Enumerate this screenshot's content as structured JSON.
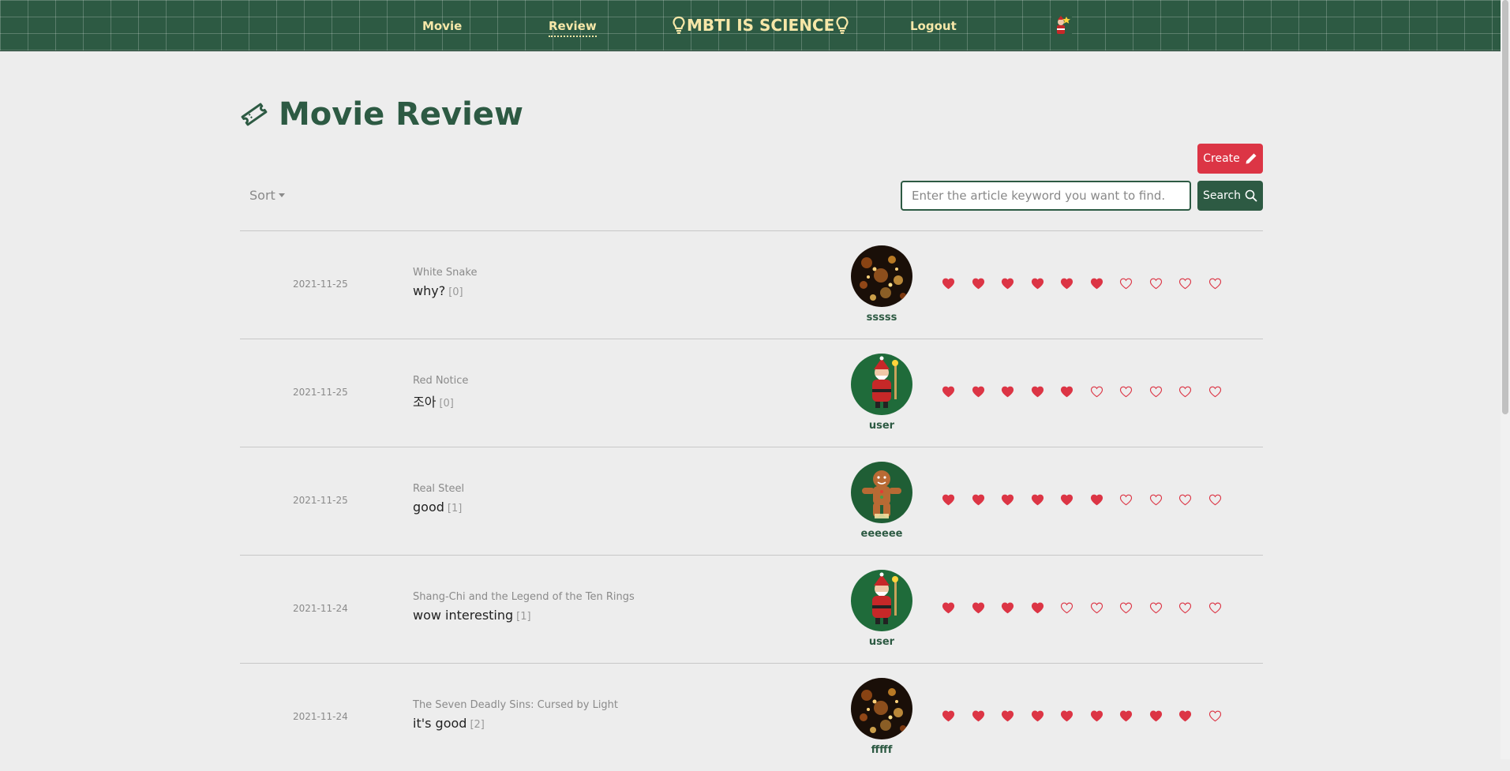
{
  "nav": {
    "movie": "Movie",
    "review": "Review",
    "brand": "MBTI IS SCIENCE",
    "logout": "Logout"
  },
  "page": {
    "title": "Movie Review"
  },
  "actions": {
    "create_label": "Create",
    "sort_label": "Sort",
    "search_placeholder": "Enter the article keyword you want to find.",
    "search_label": "Search"
  },
  "reviews": [
    {
      "date": "2021-11-25",
      "movie": "White Snake",
      "title": "why?",
      "comments": "[0]",
      "user": "sssss",
      "avatar": "lights",
      "rating": 6
    },
    {
      "date": "2021-11-25",
      "movie": "Red Notice",
      "title": "조아",
      "comments": "[0]",
      "user": "user",
      "avatar": "santa",
      "rating": 5
    },
    {
      "date": "2021-11-25",
      "movie": "Real Steel",
      "title": "good",
      "comments": "[1]",
      "user": "eeeeee",
      "avatar": "gingerbread",
      "rating": 6
    },
    {
      "date": "2021-11-24",
      "movie": "Shang-Chi and the Legend of the Ten Rings",
      "title": "wow interesting",
      "comments": "[1]",
      "user": "user",
      "avatar": "santa",
      "rating": 4
    },
    {
      "date": "2021-11-24",
      "movie": "The Seven Deadly Sins: Cursed by Light",
      "title": "it's good",
      "comments": "[2]",
      "user": "fffff",
      "avatar": "lights",
      "rating": 9
    }
  ],
  "rating_max": 10,
  "colors": {
    "primary": "#2d5a43",
    "accent": "#dc3545",
    "nav_text": "#f6e7a8",
    "background": "#ededed"
  }
}
